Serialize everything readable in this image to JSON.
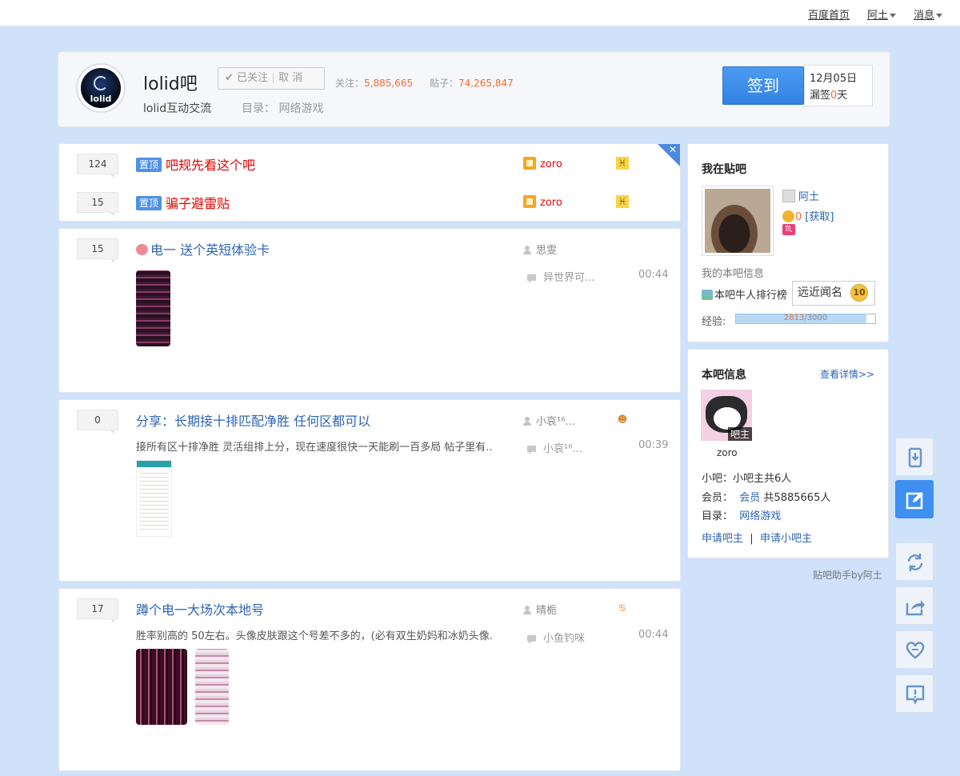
{
  "topbar": {
    "home": "百度首页",
    "user": "阿土",
    "messages": "消息"
  },
  "forum": {
    "name": "lolid吧",
    "logo_text": "lolid",
    "follow_label": "已关注",
    "unfollow_label": "取 消",
    "followers_label": "关注：",
    "followers": "5,885,665",
    "posts_label": "贴子：",
    "posts": "74,265,847",
    "desc": "lolid互动交流",
    "dir_label": "目录：",
    "dir_value": "网络游戏",
    "sign_label": "签到",
    "sign_date": "12月05日",
    "miss_prefix": "漏签",
    "miss_count": "0",
    "miss_suffix": "天"
  },
  "pinned": [
    {
      "replies": "124",
      "tag": "置顶",
      "title": "吧规先看这个吧",
      "author": "zoro"
    },
    {
      "replies": "15",
      "tag": "置顶",
      "title": "骗子避雷贴",
      "author": "zoro"
    }
  ],
  "threads": [
    {
      "replies": "15",
      "title": "电一 送个英短体验卡",
      "author": "思雯",
      "last_reply": "异世界可...",
      "time": "00:44",
      "excerpt": ""
    },
    {
      "replies": "0",
      "title": "分享：长期接十排匹配净胜 任何区都可以",
      "author": "小哀¹⁶...",
      "last_reply": "小哀¹⁶...",
      "time": "00:39",
      "excerpt": "接所有区十排净胜 灵活组排上分，现在速度很快一天能刷一百多局 帖子里有..."
    },
    {
      "replies": "17",
      "title": "蹲个电一大场次本地号",
      "author": "晴栀",
      "last_reply": "小鱼钓咪",
      "time": "00:44",
      "excerpt": "胜率别高的 50左右。头像皮肤跟这个号差不多的，(必有双生奶妈和冰奶头像..."
    }
  ],
  "mybar": {
    "title": "我在贴吧",
    "username": "阿土",
    "coins": "0",
    "get_label": "[获取]",
    "info_label": "我的本吧信息",
    "rank_label": "本吧牛人排行榜",
    "level_name": "远近闻名",
    "level": "10",
    "exp_label": "经验:",
    "exp_current": 2813,
    "exp_max": 3000,
    "exp_text": "2813/3000"
  },
  "barinfo": {
    "title": "本吧信息",
    "details_link": "查看详情>>",
    "owner_badge": "吧主",
    "owner_name": "zoro",
    "small_owner_label": "小吧：",
    "small_owner_value": "小吧主共6人",
    "members_label": "会员：",
    "members_link": "会员",
    "members_value": "共5885665人",
    "dir_label": "目录：",
    "dir_value": "网络游戏",
    "apply_owner": "申请吧主",
    "apply_small": "申请小吧主"
  },
  "footer_note": "贴吧助手by阿土",
  "colors": {
    "accent": "#3f8ff0",
    "link": "#2d64b3",
    "highlight": "#f26c35",
    "pinned_red": "#e10602"
  }
}
